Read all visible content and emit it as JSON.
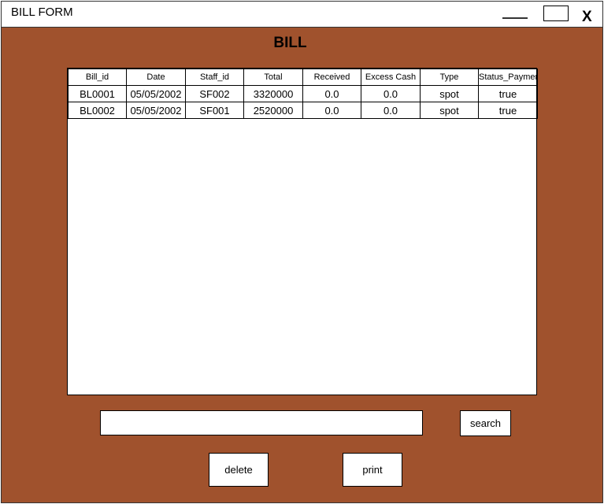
{
  "window": {
    "title": "BILL FORM",
    "close_label": "X"
  },
  "form": {
    "title": "BILL"
  },
  "table": {
    "columns": [
      "Bill_id",
      "Date",
      "Staff_id",
      "Total",
      "Received",
      "Excess Cash",
      "Type",
      "Status_Payment"
    ],
    "rows": [
      [
        "BL0001",
        "05/05/2002",
        "SF002",
        "3320000",
        "0.0",
        "0.0",
        "spot",
        "true"
      ],
      [
        "BL0002",
        "05/05/2002",
        "SF001",
        "2520000",
        "0.0",
        "0.0",
        "spot",
        "true"
      ]
    ]
  },
  "search": {
    "value": "",
    "button_label": "search"
  },
  "actions": {
    "delete_label": "delete",
    "print_label": "print"
  },
  "colors": {
    "background": "#a0522d",
    "panel": "#ffffff"
  }
}
